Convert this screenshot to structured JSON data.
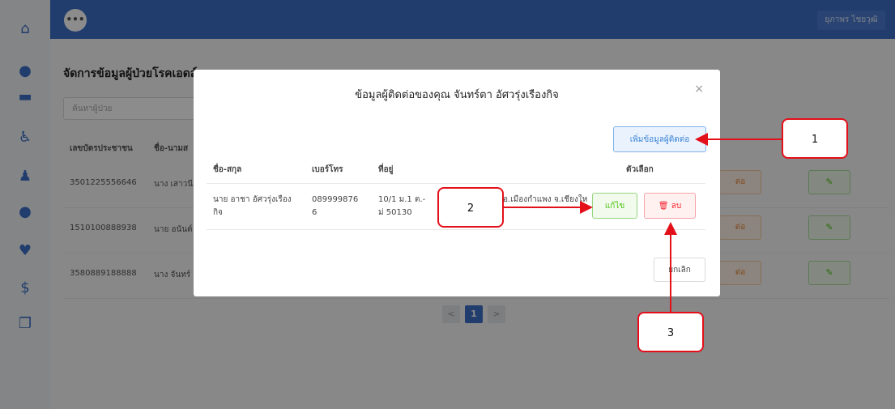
{
  "topbar": {
    "menu_icon_label": "•••",
    "user_name": "ยุภาพร ไชยวุฒิ"
  },
  "sidebar": {
    "icons": [
      "home-icon",
      "user-icon",
      "bed-icon",
      "wheelchair-icon",
      "people-icon",
      "location-icon",
      "heart-icon",
      "dollar-icon",
      "copy-icon"
    ]
  },
  "page": {
    "title": "จัดการข้อมูลผู้ป่วยโรคเอดส์",
    "search_placeholder": "ค้นหาผู้ป่วย",
    "columns": [
      "เลขบัตรประชาชน",
      "ชื่อ-นามส"
    ],
    "rows": [
      {
        "id": "3501225556646",
        "name": "นาง เสาวนี"
      },
      {
        "id": "1510100888938",
        "name": "นาย อนันต์"
      },
      {
        "id": "3580889188888",
        "name": "นาง จันทร์"
      }
    ],
    "row_contact_label": "ต่อ",
    "row_edit_label": "✎",
    "pagination": {
      "prev": "<",
      "current": "1",
      "next": ">"
    }
  },
  "modal": {
    "title": "ข้อมูลผู้ติดต่อของคุณ จันทร์ตา อัศวรุ่งเรืองกิจ",
    "close": "×",
    "add_button": "เพิ่มข้อมูลผู้ติดต่อ",
    "columns": {
      "name": "ชื่อ-สกุล",
      "phone": "เบอร์โทร",
      "address": "ที่อยู่",
      "options": "ตัวเลือก"
    },
    "row": {
      "name_line1": "นาย อาชา อัศวรุ่งเรือง",
      "name_line2": "กิจ",
      "phone_line1": "089999876",
      "phone_line2": "6",
      "address_line1": "10/1 ม.1 ต.-",
      "address_line1b": "อ.เมืองกำแพง จ.เชียงให",
      "address_line2": "ม่ 50130"
    },
    "edit_button": "แก้ไข",
    "delete_icon": "🗑",
    "delete_button": "ลบ",
    "cancel_button": "ยกเลิก"
  },
  "callouts": {
    "one": "1",
    "two": "2",
    "three": "3"
  },
  "colors": {
    "primary": "#3b6fc6",
    "callout_border": "#e3101a"
  }
}
